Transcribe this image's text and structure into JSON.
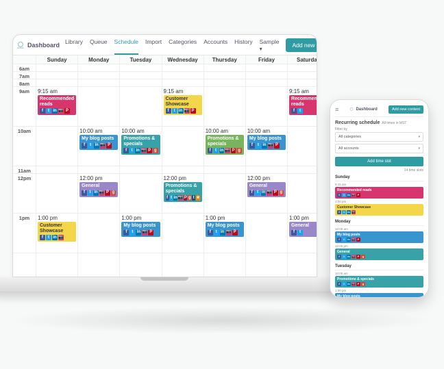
{
  "brand": "Dashboard",
  "nav": {
    "items": [
      {
        "label": "Library"
      },
      {
        "label": "Queue"
      },
      {
        "label": "Schedule",
        "active": true
      },
      {
        "label": "Import"
      },
      {
        "label": "Categories"
      },
      {
        "label": "Accounts"
      },
      {
        "label": "History"
      },
      {
        "label": "Sample",
        "dropdown": true
      }
    ],
    "new_content": "Add new content"
  },
  "days": [
    "Sunday",
    "Monday",
    "Tuesday",
    "Wednesday",
    "Thursday",
    "Friday",
    "Saturday"
  ],
  "hours": [
    "6am",
    "7am",
    "8am",
    "9am",
    "10am",
    "11am",
    "12pm",
    "1pm"
  ],
  "events": {
    "Sunday": {
      "9am": {
        "time": "9:15 am",
        "title": "Recommended reads",
        "color": "pink",
        "icons": [
          "fb",
          "tw",
          "li",
          "ig",
          "pi"
        ]
      },
      "1pm": {
        "time": "1:00 pm",
        "title": "Customer Showcase",
        "color": "yellow",
        "icons": [
          "fb",
          "tw",
          "li",
          "ig"
        ]
      }
    },
    "Monday": {
      "10am": {
        "time": "10:00 am",
        "title": "My blog posts",
        "color": "blue",
        "icons": [
          "fb",
          "tw",
          "li",
          "ig",
          "pi"
        ]
      },
      "12pm": {
        "time": "12:00 pm",
        "title": "General",
        "color": "purple",
        "icons": [
          "fb",
          "tw",
          "li",
          "ig",
          "pi",
          "gp"
        ]
      }
    },
    "Tuesday": {
      "10am": {
        "time": "10:00 am",
        "title": "Promotions & specials",
        "color": "teal",
        "icons": [
          "fb",
          "tw",
          "li",
          "ig",
          "pi",
          "gp"
        ]
      },
      "1pm": {
        "time": "1:00 pm",
        "title": "My blog posts",
        "color": "blue",
        "icons": [
          "fb",
          "tw",
          "li",
          "ig",
          "pi"
        ]
      }
    },
    "Wednesday": {
      "9am": {
        "time": "9:15 am",
        "title": "Customer Showcase",
        "color": "yellow",
        "icons": [
          "fb",
          "tw",
          "li",
          "ig",
          "pi"
        ]
      },
      "12pm": {
        "time": "12:00 pm",
        "title": "Promotions & specials",
        "color": "teal",
        "icons": [
          "fb",
          "tw",
          "li",
          "ig",
          "pi",
          "gp",
          "tu",
          "fs"
        ]
      }
    },
    "Thursday": {
      "10am": {
        "time": "10:00 am",
        "title": "Promotions & specials",
        "color": "green",
        "icons": [
          "fb",
          "tw",
          "li",
          "ig",
          "pi",
          "gp"
        ]
      },
      "1pm": {
        "time": "1:00 pm",
        "title": "My blog posts",
        "color": "blue",
        "icons": [
          "fb",
          "tw",
          "li",
          "ig",
          "pi"
        ]
      }
    },
    "Friday": {
      "10am": {
        "time": "10:00 am",
        "title": "My blog posts",
        "color": "blue",
        "icons": [
          "fb",
          "tw",
          "li",
          "ig",
          "pi"
        ]
      },
      "12pm": {
        "time": "12:00 pm",
        "title": "General",
        "color": "purple",
        "icons": [
          "fb",
          "tw",
          "li",
          "ig",
          "pi",
          "gp"
        ]
      }
    },
    "Saturday": {
      "9am": {
        "time": "9:15 am",
        "title": "Recommended reads",
        "color": "pink",
        "icons": [
          "fb",
          "tw"
        ]
      },
      "1pm": {
        "time": "1:00 pm",
        "title": "General",
        "color": "purple",
        "icons": [
          "fb",
          "tw"
        ]
      }
    }
  },
  "phone": {
    "brand": "Dashboard",
    "btn": "Add new content",
    "title": "Recurring schedule",
    "title_sub": "All times in MST",
    "filter_label": "Filter by",
    "filter_cat": "All categories",
    "filter_acc": "All accounts",
    "add_slot": "Add time slot",
    "count": "14 time slots",
    "days": [
      {
        "name": "Sunday",
        "events": [
          {
            "time": "9:15 am",
            "title": "Recommended reads",
            "color": "pink",
            "icons": [
              "fb",
              "tw",
              "li",
              "ig",
              "pi"
            ]
          },
          {
            "time": "1:00 pm",
            "title": "Customer Showcase",
            "color": "yellow",
            "icons": [
              "fb",
              "tw",
              "li",
              "ig"
            ]
          }
        ]
      },
      {
        "name": "Monday",
        "events": [
          {
            "time": "10:00 am",
            "title": "My blog posts",
            "color": "blue",
            "icons": [
              "fb",
              "tw",
              "li",
              "ig",
              "pi"
            ]
          },
          {
            "time": "12:00 pm",
            "title": "General",
            "color": "teal",
            "icons": [
              "fb",
              "tw",
              "li",
              "ig",
              "pi",
              "gp"
            ]
          }
        ]
      },
      {
        "name": "Tuesday",
        "events": [
          {
            "time": "10:00 am",
            "title": "Promotions & specials",
            "color": "teal",
            "icons": [
              "fb",
              "tw",
              "li",
              "ig",
              "pi",
              "gp"
            ]
          },
          {
            "time": "1:00 pm",
            "title": "My blog posts",
            "color": "blue",
            "icons": [
              "fb",
              "tw",
              "li",
              "ig",
              "pi"
            ]
          }
        ]
      }
    ]
  }
}
